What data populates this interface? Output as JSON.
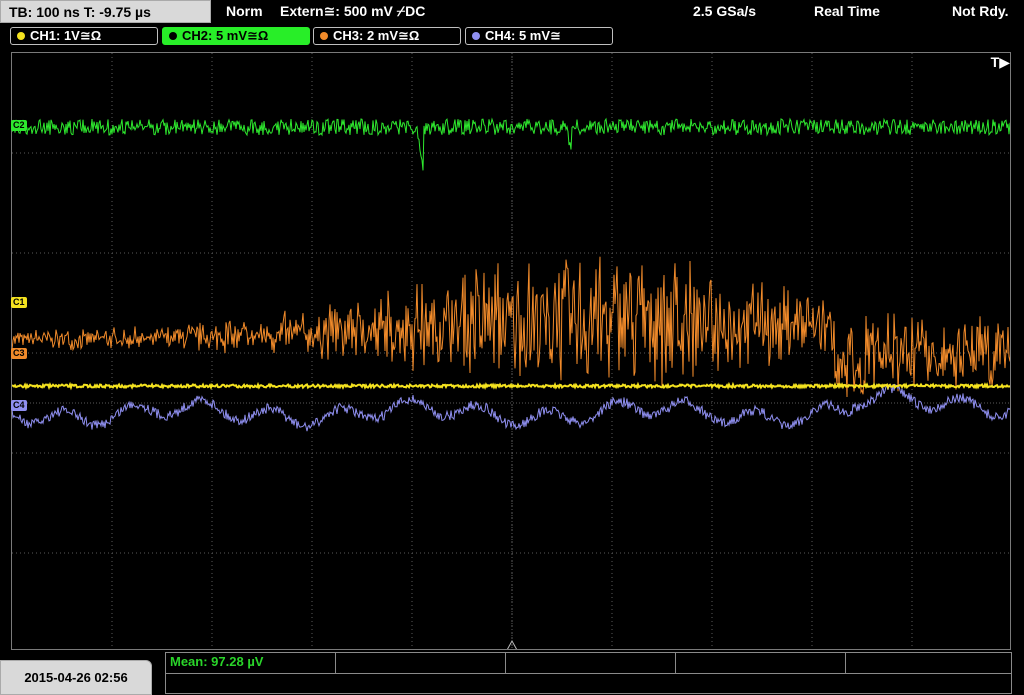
{
  "topbar": {
    "timebase": "TB: 100 ns   T: -9.75 µs",
    "mode": "Norm",
    "trigger": "Extern≅: 500 mV ⌿DC",
    "sample_rate": "2.5 GSa/s",
    "acq_mode": "Real Time",
    "status": "Not Rdy."
  },
  "channels": [
    {
      "label": "CH1: 1V≅Ω",
      "color": "#f4e21f",
      "active": false
    },
    {
      "label": "CH2: 5 mV≅Ω",
      "color": "#2ee82e",
      "active": true
    },
    {
      "label": "CH3: 2 mV≅Ω",
      "color": "#f08a2a",
      "active": false
    },
    {
      "label": "CH4: 5 mV≅",
      "color": "#8f8ff0",
      "active": false
    }
  ],
  "markers": {
    "c2": "C2",
    "c1": "C1",
    "c3": "C3",
    "c4": "C4"
  },
  "trigger_marker": "T▶",
  "footer": {
    "datetime": "2015-04-26 02:56",
    "mean": "Mean: 97.28 µV"
  },
  "colors": {
    "ch1": "#f4e21f",
    "ch2": "#2ee82e",
    "ch3": "#f08a2a",
    "ch4": "#8f8ff0",
    "grid": "#5a5a5a"
  }
}
